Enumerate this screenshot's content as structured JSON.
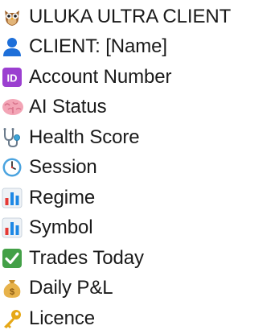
{
  "panel": {
    "items": [
      {
        "icon": "owl-icon",
        "label": "ULUKA ULTRA CLIENT"
      },
      {
        "icon": "person-silhouette-icon",
        "label": "CLIENT: [Name]"
      },
      {
        "icon": "id-badge-icon",
        "label": "Account Number"
      },
      {
        "icon": "brain-icon",
        "label": "AI Status"
      },
      {
        "icon": "stethoscope-icon",
        "label": "Health Score"
      },
      {
        "icon": "clock-icon",
        "label": "Session"
      },
      {
        "icon": "bar-chart-icon",
        "label": "Regime"
      },
      {
        "icon": "bar-chart-icon",
        "label": "Symbol"
      },
      {
        "icon": "check-mark-icon",
        "label": "Trades Today"
      },
      {
        "icon": "money-bag-icon",
        "label": "Daily P&L"
      },
      {
        "icon": "key-icon",
        "label": "Licence"
      }
    ]
  },
  "colors": {
    "text": "#1a1a1a",
    "id_badge": "#9b3fd0",
    "check_green": "#43a047",
    "person_blue": "#1e6fd9",
    "brain_pink": "#f0a0b0",
    "key_gold": "#e6a817"
  }
}
